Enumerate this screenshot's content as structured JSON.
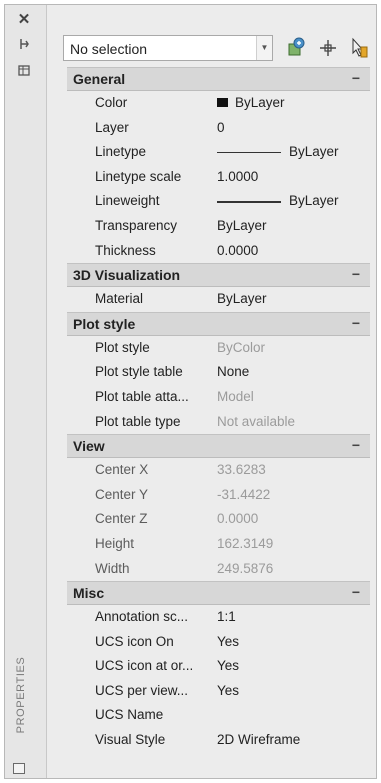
{
  "palette": {
    "title": "PROPERTIES",
    "close_icon": "close-icon",
    "pin_icon": "auto-hide-icon",
    "menu_icon": "properties-menu-icon",
    "bottom_icon": "palette-customize-icon"
  },
  "selector": {
    "value": "No selection",
    "icons": [
      "toggle-pickadd-icon",
      "select-objects-icon",
      "quick-select-icon"
    ]
  },
  "sections": [
    {
      "title": "General",
      "rows": [
        {
          "name": "Color",
          "value": "ByLayer",
          "swatch": "#111111"
        },
        {
          "name": "Layer",
          "value": "0"
        },
        {
          "name": "Linetype",
          "value": "ByLayer",
          "line": true
        },
        {
          "name": "Linetype scale",
          "value": "1.0000"
        },
        {
          "name": "Lineweight",
          "value": "ByLayer",
          "line": true
        },
        {
          "name": "Transparency",
          "value": "ByLayer"
        },
        {
          "name": "Thickness",
          "value": "0.0000"
        }
      ]
    },
    {
      "title": "3D Visualization",
      "rows": [
        {
          "name": "Material",
          "value": "ByLayer"
        }
      ]
    },
    {
      "title": "Plot style",
      "rows": [
        {
          "name": "Plot style",
          "value": "ByColor",
          "dim": true
        },
        {
          "name": "Plot style table",
          "value": "None"
        },
        {
          "name": "Plot table atta...",
          "value": "Model",
          "dim": true
        },
        {
          "name": "Plot table type",
          "value": "Not available",
          "dim": true
        }
      ]
    },
    {
      "title": "View",
      "rows": [
        {
          "name": "Center X",
          "value": "33.6283",
          "dim": true,
          "dimname": true
        },
        {
          "name": "Center Y",
          "value": "-31.4422",
          "dim": true,
          "dimname": true
        },
        {
          "name": "Center Z",
          "value": "0.0000",
          "dim": true,
          "dimname": true
        },
        {
          "name": "Height",
          "value": "162.3149",
          "dim": true,
          "dimname": true
        },
        {
          "name": "Width",
          "value": "249.5876",
          "dim": true,
          "dimname": true
        }
      ]
    },
    {
      "title": "Misc",
      "rows": [
        {
          "name": "Annotation sc...",
          "value": "1:1"
        },
        {
          "name": "UCS icon On",
          "value": "Yes"
        },
        {
          "name": "UCS icon at or...",
          "value": "Yes"
        },
        {
          "name": "UCS per view...",
          "value": "Yes"
        },
        {
          "name": "UCS Name",
          "value": ""
        },
        {
          "name": "Visual Style",
          "value": "2D Wireframe"
        }
      ]
    }
  ],
  "collapse_glyph": "−"
}
